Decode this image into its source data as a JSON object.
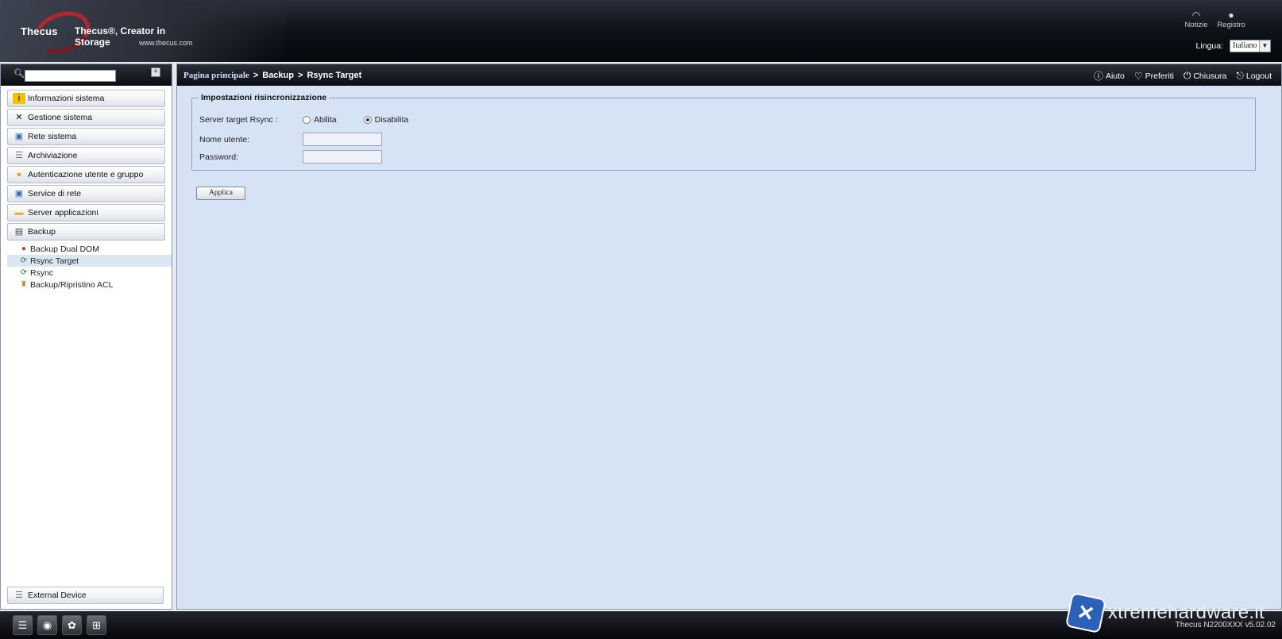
{
  "header": {
    "logo_text": "Thecus",
    "tagline": "Thecus®, Creator in Storage",
    "url": "www.thecus.com",
    "icons": [
      {
        "name": "rss-icon",
        "label": "Notizie"
      },
      {
        "name": "registry-icon",
        "label": "Registro"
      }
    ],
    "language_label": "Lingua:",
    "language_value": "Italiano"
  },
  "sidebar": {
    "menu": [
      {
        "label": "Informazioni sistema",
        "icon": "info-icon"
      },
      {
        "label": "Gestione sistema",
        "icon": "tools-icon"
      },
      {
        "label": "Rete sistema",
        "icon": "network-icon"
      },
      {
        "label": "Archiviazione",
        "icon": "storage-icon"
      },
      {
        "label": "Autenticazione utente e gruppo",
        "icon": "users-icon"
      },
      {
        "label": "Service di rete",
        "icon": "network-service-icon"
      },
      {
        "label": "Server applicazioni",
        "icon": "folder-icon"
      },
      {
        "label": "Backup",
        "icon": "backup-icon"
      }
    ],
    "backup_items": [
      {
        "label": "Backup Dual DOM",
        "active": false
      },
      {
        "label": "Rsync Target",
        "active": true
      },
      {
        "label": "Rsync",
        "active": false
      },
      {
        "label": "Backup/Ripristino ACL",
        "active": false
      }
    ],
    "external_device": "External Device"
  },
  "breadcrumb": {
    "home": "Pagina principale",
    "sep": ">",
    "section": "Backup",
    "page": "Rsync Target"
  },
  "toolbar": {
    "help": "Aiuto",
    "favorites": "Preferiti",
    "shutdown": "Chiusura",
    "logout": "Logout"
  },
  "form": {
    "legend": "Impostazioni risincronizzazione",
    "server_label": "Server target Rsync :",
    "enable_label": "Abilita",
    "disable_label": "Disabilita",
    "selected": "Disabilita",
    "username_label": "Nome utente:",
    "username_value": "",
    "password_label": "Password:",
    "password_value": "",
    "apply_label": "Applica"
  },
  "footer": {
    "version": "Thecus N2200XXX v5.02.02",
    "watermark": "xtremehardware.it"
  }
}
